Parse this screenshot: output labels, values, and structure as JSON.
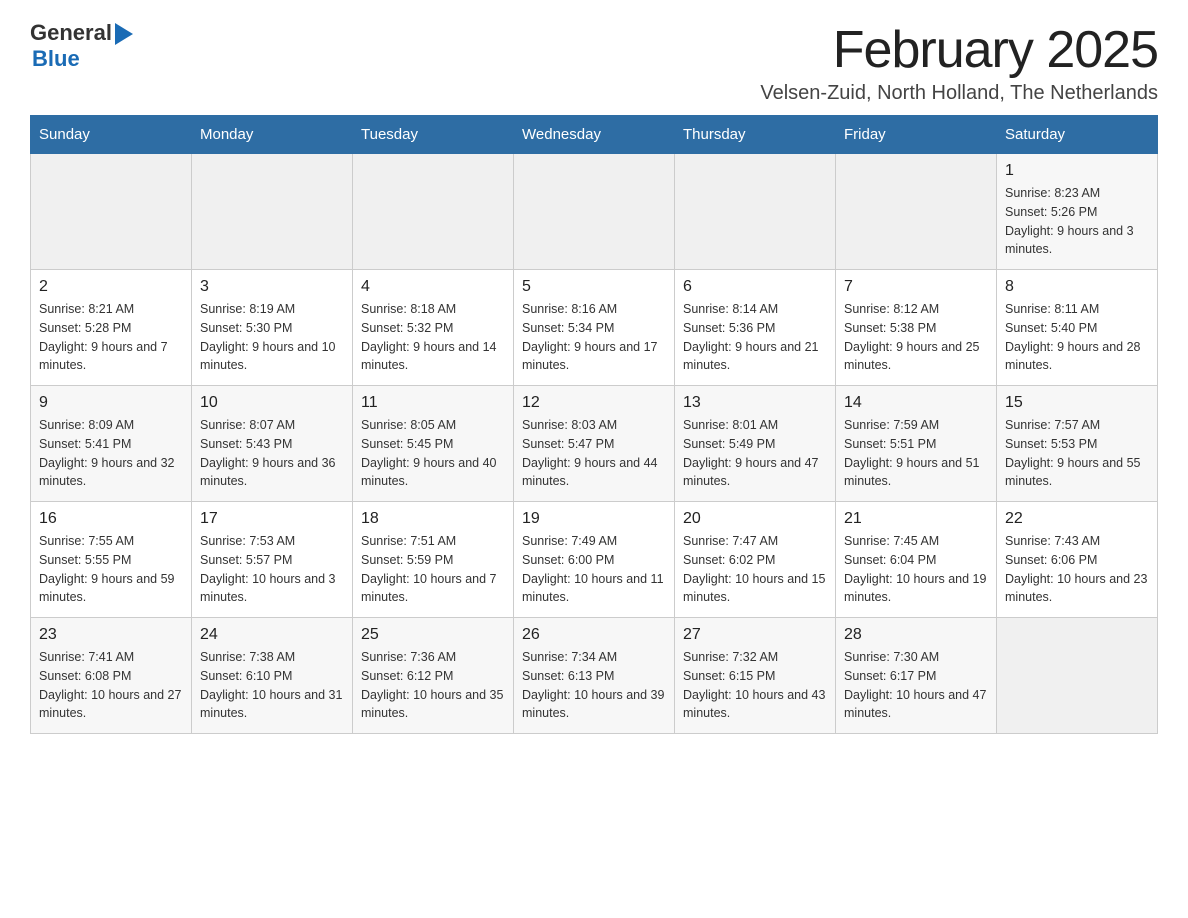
{
  "header": {
    "logo_general": "General",
    "logo_blue": "Blue",
    "title": "February 2025",
    "subtitle": "Velsen-Zuid, North Holland, The Netherlands"
  },
  "days_of_week": [
    "Sunday",
    "Monday",
    "Tuesday",
    "Wednesday",
    "Thursday",
    "Friday",
    "Saturday"
  ],
  "weeks": [
    {
      "days": [
        {
          "number": "",
          "info": ""
        },
        {
          "number": "",
          "info": ""
        },
        {
          "number": "",
          "info": ""
        },
        {
          "number": "",
          "info": ""
        },
        {
          "number": "",
          "info": ""
        },
        {
          "number": "",
          "info": ""
        },
        {
          "number": "1",
          "info": "Sunrise: 8:23 AM\nSunset: 5:26 PM\nDaylight: 9 hours and 3 minutes."
        }
      ]
    },
    {
      "days": [
        {
          "number": "2",
          "info": "Sunrise: 8:21 AM\nSunset: 5:28 PM\nDaylight: 9 hours and 7 minutes."
        },
        {
          "number": "3",
          "info": "Sunrise: 8:19 AM\nSunset: 5:30 PM\nDaylight: 9 hours and 10 minutes."
        },
        {
          "number": "4",
          "info": "Sunrise: 8:18 AM\nSunset: 5:32 PM\nDaylight: 9 hours and 14 minutes."
        },
        {
          "number": "5",
          "info": "Sunrise: 8:16 AM\nSunset: 5:34 PM\nDaylight: 9 hours and 17 minutes."
        },
        {
          "number": "6",
          "info": "Sunrise: 8:14 AM\nSunset: 5:36 PM\nDaylight: 9 hours and 21 minutes."
        },
        {
          "number": "7",
          "info": "Sunrise: 8:12 AM\nSunset: 5:38 PM\nDaylight: 9 hours and 25 minutes."
        },
        {
          "number": "8",
          "info": "Sunrise: 8:11 AM\nSunset: 5:40 PM\nDaylight: 9 hours and 28 minutes."
        }
      ]
    },
    {
      "days": [
        {
          "number": "9",
          "info": "Sunrise: 8:09 AM\nSunset: 5:41 PM\nDaylight: 9 hours and 32 minutes."
        },
        {
          "number": "10",
          "info": "Sunrise: 8:07 AM\nSunset: 5:43 PM\nDaylight: 9 hours and 36 minutes."
        },
        {
          "number": "11",
          "info": "Sunrise: 8:05 AM\nSunset: 5:45 PM\nDaylight: 9 hours and 40 minutes."
        },
        {
          "number": "12",
          "info": "Sunrise: 8:03 AM\nSunset: 5:47 PM\nDaylight: 9 hours and 44 minutes."
        },
        {
          "number": "13",
          "info": "Sunrise: 8:01 AM\nSunset: 5:49 PM\nDaylight: 9 hours and 47 minutes."
        },
        {
          "number": "14",
          "info": "Sunrise: 7:59 AM\nSunset: 5:51 PM\nDaylight: 9 hours and 51 minutes."
        },
        {
          "number": "15",
          "info": "Sunrise: 7:57 AM\nSunset: 5:53 PM\nDaylight: 9 hours and 55 minutes."
        }
      ]
    },
    {
      "days": [
        {
          "number": "16",
          "info": "Sunrise: 7:55 AM\nSunset: 5:55 PM\nDaylight: 9 hours and 59 minutes."
        },
        {
          "number": "17",
          "info": "Sunrise: 7:53 AM\nSunset: 5:57 PM\nDaylight: 10 hours and 3 minutes."
        },
        {
          "number": "18",
          "info": "Sunrise: 7:51 AM\nSunset: 5:59 PM\nDaylight: 10 hours and 7 minutes."
        },
        {
          "number": "19",
          "info": "Sunrise: 7:49 AM\nSunset: 6:00 PM\nDaylight: 10 hours and 11 minutes."
        },
        {
          "number": "20",
          "info": "Sunrise: 7:47 AM\nSunset: 6:02 PM\nDaylight: 10 hours and 15 minutes."
        },
        {
          "number": "21",
          "info": "Sunrise: 7:45 AM\nSunset: 6:04 PM\nDaylight: 10 hours and 19 minutes."
        },
        {
          "number": "22",
          "info": "Sunrise: 7:43 AM\nSunset: 6:06 PM\nDaylight: 10 hours and 23 minutes."
        }
      ]
    },
    {
      "days": [
        {
          "number": "23",
          "info": "Sunrise: 7:41 AM\nSunset: 6:08 PM\nDaylight: 10 hours and 27 minutes."
        },
        {
          "number": "24",
          "info": "Sunrise: 7:38 AM\nSunset: 6:10 PM\nDaylight: 10 hours and 31 minutes."
        },
        {
          "number": "25",
          "info": "Sunrise: 7:36 AM\nSunset: 6:12 PM\nDaylight: 10 hours and 35 minutes."
        },
        {
          "number": "26",
          "info": "Sunrise: 7:34 AM\nSunset: 6:13 PM\nDaylight: 10 hours and 39 minutes."
        },
        {
          "number": "27",
          "info": "Sunrise: 7:32 AM\nSunset: 6:15 PM\nDaylight: 10 hours and 43 minutes."
        },
        {
          "number": "28",
          "info": "Sunrise: 7:30 AM\nSunset: 6:17 PM\nDaylight: 10 hours and 47 minutes."
        },
        {
          "number": "",
          "info": ""
        }
      ]
    }
  ]
}
